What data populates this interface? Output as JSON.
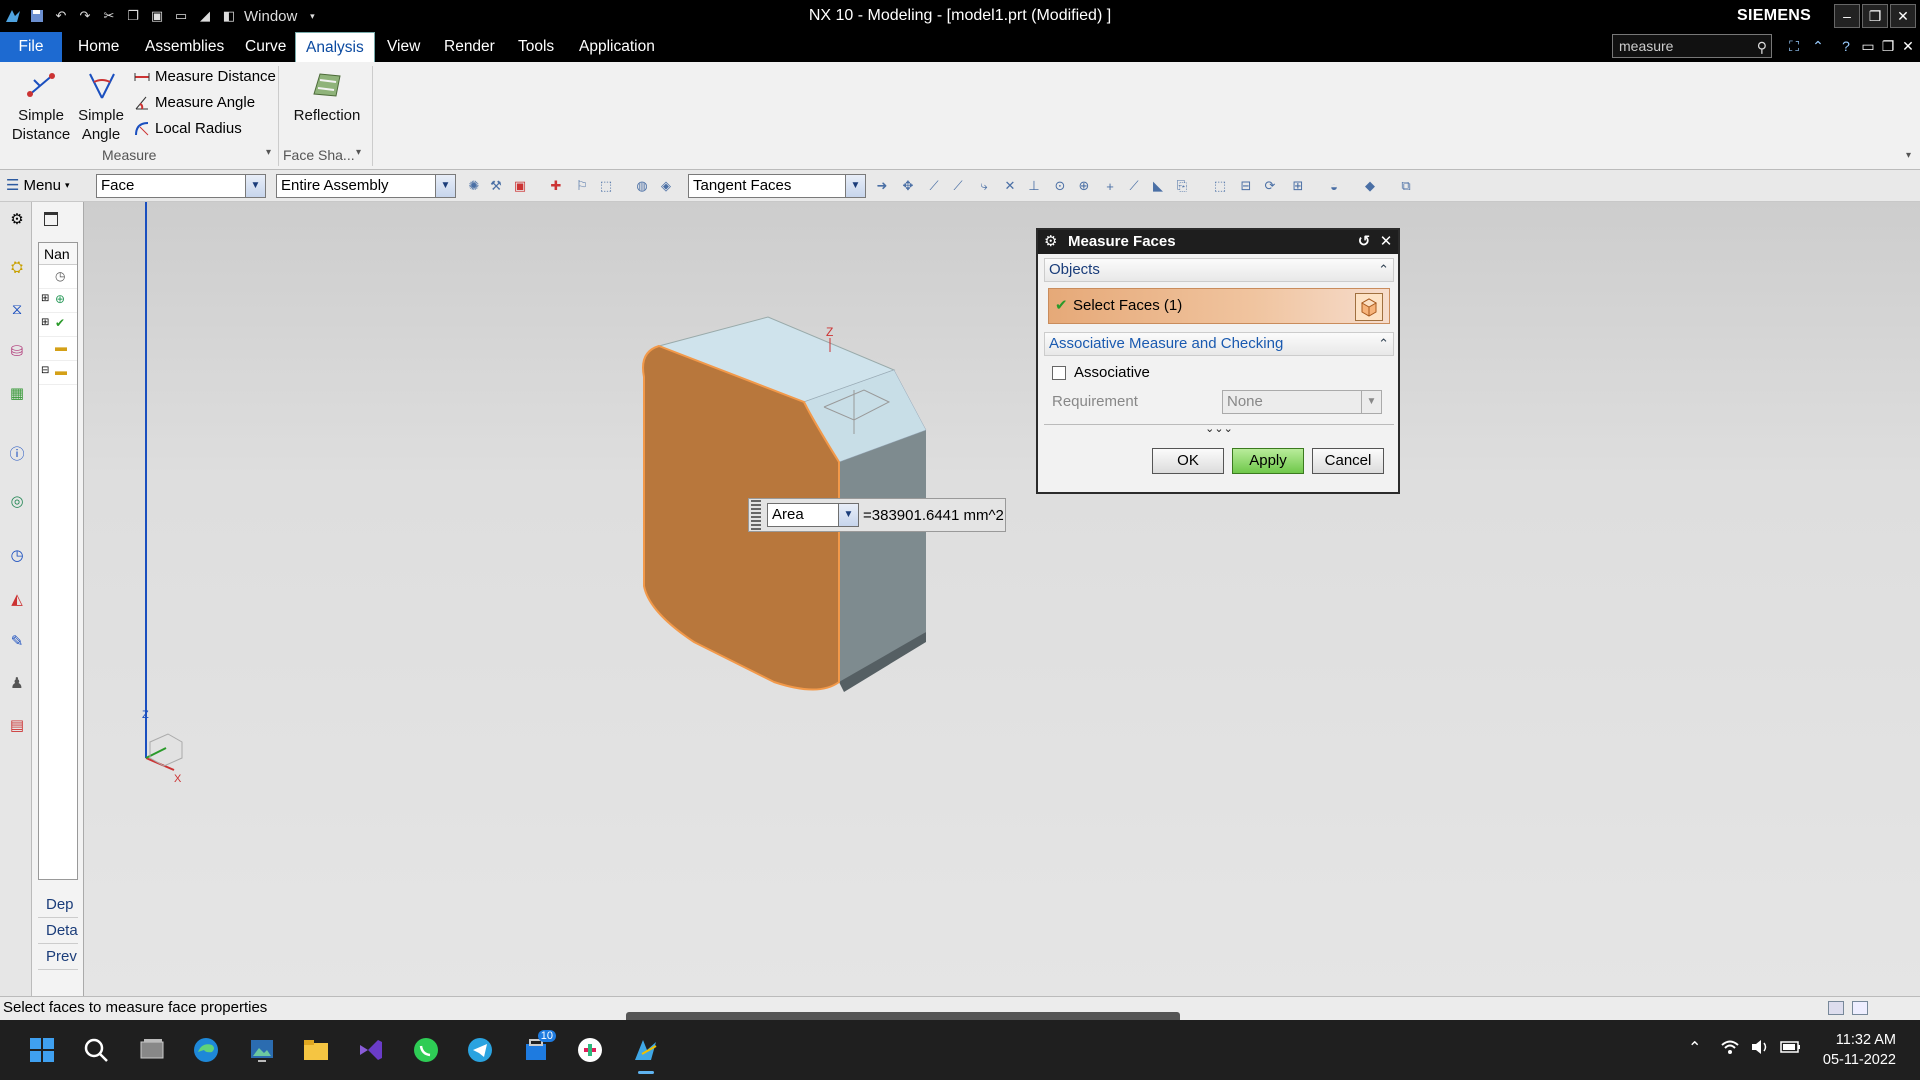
{
  "window": {
    "title": "NX 10 - Modeling - [model1.prt (Modified) ]",
    "brand": "SIEMENS",
    "window_menu": "Window"
  },
  "tabs": [
    "File",
    "Home",
    "Assemblies",
    "Curve",
    "Analysis",
    "View",
    "Render",
    "Tools",
    "Application"
  ],
  "active_tab": "Analysis",
  "search": {
    "value": "measure"
  },
  "ribbon": {
    "simple_distance": [
      "Simple",
      "Distance"
    ],
    "simple_angle": [
      "Simple",
      "Angle"
    ],
    "measure_distance": "Measure Distance",
    "measure_angle": "Measure Angle",
    "local_radius": "Local Radius",
    "reflection": "Reflection",
    "group_measure": "Measure",
    "group_face_shape": "Face Sha..."
  },
  "toolbar": {
    "menu": "Menu",
    "filter_type": "Face",
    "scope": "Entire Assembly",
    "face_rule": "Tangent Faces"
  },
  "nav": {
    "header": "Nan",
    "bottom": [
      "Dep",
      "Deta",
      "Prev"
    ]
  },
  "area_popup": {
    "type": "Area",
    "value": "=383901.6441 mm^2"
  },
  "dialog": {
    "title": "Measure Faces",
    "section_objects": "Objects",
    "select_faces": "Select Faces (1)",
    "section_assoc": "Associative Measure and Checking",
    "associative": "Associative",
    "requirement_label": "Requirement",
    "requirement_value": "None",
    "ok": "OK",
    "apply": "Apply",
    "cancel": "Cancel"
  },
  "triad": {
    "z": "Z",
    "x": "X"
  },
  "status": "Select faces to measure face properties",
  "taskbar": {
    "time": "11:32 AM",
    "date": "05-11-2022",
    "badge": "10"
  },
  "colors": {
    "accent": "#1d6ad1",
    "selected_face": "#b8773c",
    "apply_green": "#6fc84a"
  }
}
